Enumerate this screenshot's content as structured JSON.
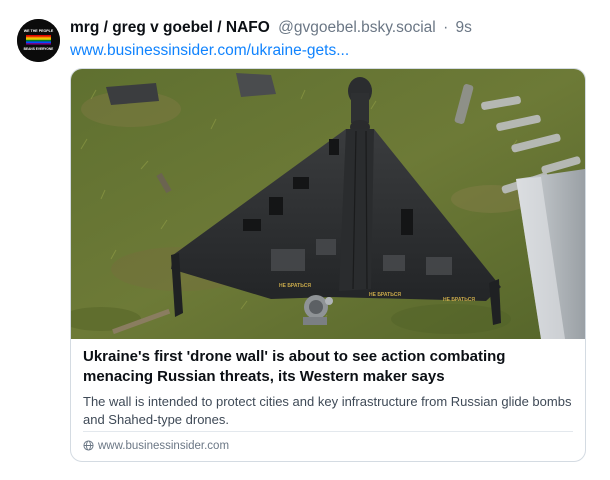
{
  "post": {
    "author": {
      "display_name": "mrg / greg v goebel / NAFO",
      "handle": "@gvgoebel.bsky.social",
      "time_ago": "9s",
      "avatar_text": [
        "WE THE PEOPLE",
        "BEANS EVERYONE"
      ]
    },
    "link_text": "www.businessinsider.com/ukraine-gets...",
    "embed": {
      "image_icon": "drone-photo",
      "title": "Ukraine's first 'drone wall' is about to see action combating menacing Russian threats, its Western maker says",
      "description": "The wall is intended to protect cities and key infrastructure from Russian glide bombs and Shahed-type drones.",
      "domain": "www.businessinsider.com",
      "domain_icon": "globe-icon"
    }
  },
  "colors": {
    "link": "#1083fe",
    "muted": "#6b7785",
    "border": "#d4dbe2"
  }
}
